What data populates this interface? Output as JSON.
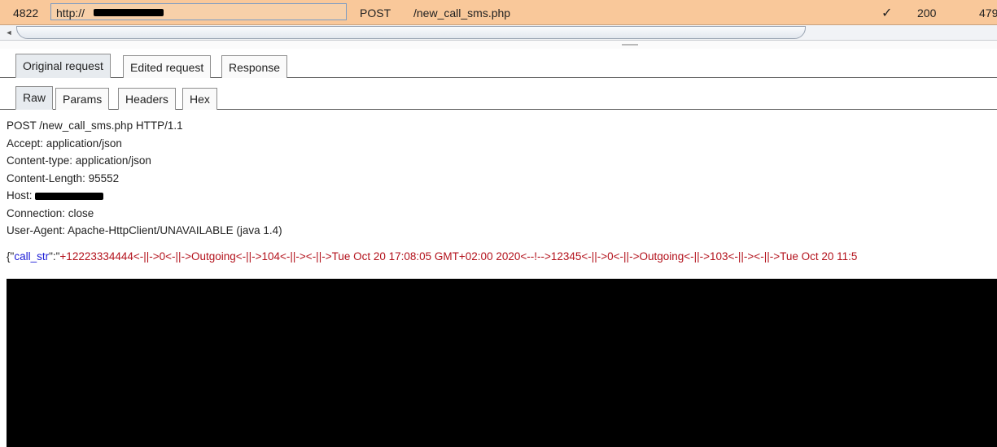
{
  "history_row": {
    "number": "4822",
    "host_prefix": "http://",
    "method": "POST",
    "url": "/new_call_sms.php",
    "check": "✓",
    "status": "200",
    "length": "479"
  },
  "scroll": {
    "left_arrow": "◄"
  },
  "top_tabs": [
    "Original request",
    "Edited request",
    "Response"
  ],
  "view_tabs": [
    "Raw",
    "Params",
    "Headers",
    "Hex"
  ],
  "request": {
    "request_line": "POST /new_call_sms.php HTTP/1.1",
    "headers": [
      "Accept: application/json",
      "Content-type: application/json",
      "Content-Length: 95552"
    ],
    "host_label": "Host: ",
    "connection": "Connection: close",
    "user_agent": "User-Agent: Apache-HttpClient/UNAVAILABLE (java 1.4)",
    "body_open": "{\"",
    "body_key": "call_str",
    "body_sep": "\":\"",
    "body_value": "+12223334444<-||->0<-||->Outgoing<-||->104<-||-><-||->Tue Oct 20 17:08:05 GMT+02:00 2020<--!-->12345<-||->0<-||->Outgoing<-||->103<-||-><-||->Tue Oct 20 11:5"
  },
  "colors": {
    "row_highlight": "#f9c89a",
    "json_key": "#1b1bd6",
    "json_value": "#b3121c",
    "redaction": "#000000"
  }
}
